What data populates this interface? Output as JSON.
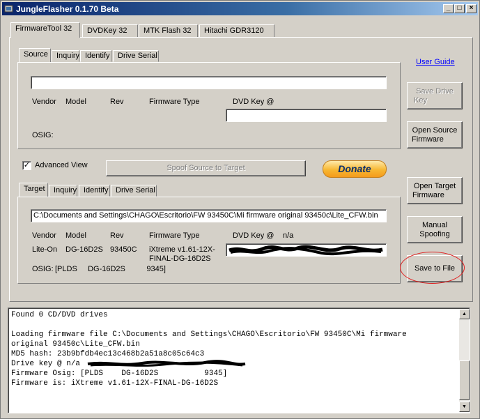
{
  "window": {
    "title": "JungleFlasher 0.1.70 Beta",
    "minimize": "_",
    "maximize": "□",
    "close": "×"
  },
  "main_tabs": [
    "FirmwareTool 32",
    "DVDKey 32",
    "MTK Flash 32",
    "Hitachi GDR3120"
  ],
  "source": {
    "tabs": [
      "Source",
      "Inquiry",
      "Identify",
      "Drive Serial"
    ],
    "path_value": "",
    "headers": {
      "vendor": "Vendor",
      "model": "Model",
      "rev": "Rev",
      "firmware_type": "Firmware Type",
      "dvd_key": "DVD Key @"
    },
    "dvd_key_value": "",
    "osig_label": "OSIG:"
  },
  "advanced_view": {
    "label": "Advanced View",
    "checked": "✓"
  },
  "spoof_button": "Spoof Source to Target",
  "donate_button": "Donate",
  "target": {
    "tabs": [
      "Target",
      "Inquiry",
      "Identify",
      "Drive Serial"
    ],
    "path_value": "C:\\Documents and Settings\\CHAGO\\Escritorio\\FW 93450C\\Mi firmware original 93450c\\Lite_CFW.bin",
    "headers": {
      "vendor": "Vendor",
      "model": "Model",
      "rev": "Rev",
      "firmware_type": "Firmware Type",
      "dvd_key": "DVD Key @",
      "dvd_key_at": "n/a"
    },
    "vendor": "Lite-On",
    "model": "DG-16D2S",
    "rev": "93450C",
    "firmware_type_line1": "iXtreme v1.61-12X-",
    "firmware_type_line2": "FINAL-DG-16D2S",
    "osig_label": "OSIG:",
    "osig_value": "[PLDS     DG-16D2S          9345]"
  },
  "right_buttons": {
    "user_guide": "User Guide",
    "save_drive_key": [
      "Save Drive",
      "Key"
    ],
    "open_source_firmware": [
      "Open Source",
      "Firmware"
    ],
    "open_target_firmware": [
      "Open Target",
      "Firmware"
    ],
    "manual_spoofing": [
      "Manual",
      "Spoofing"
    ],
    "save_to_file": "Save to File"
  },
  "log_lines": [
    "Found 0 CD/DVD drives",
    "",
    "Loading firmware file C:\\Documents and Settings\\CHAGO\\Escritorio\\FW 93450C\\Mi firmware",
    "original 93450c\\Lite_CFW.bin",
    "MD5 hash:  23b9bfdb4ec13c468b2a51a8c05c64c3",
    "Drive key @ n/a",
    "Firmware Osig: [PLDS    DG-16D2S          9345]",
    "Firmware is:  iXtreme v1.61-12X-FINAL-DG-16D2S"
  ],
  "colors": {
    "title_start": "#0a246a",
    "title_end": "#a6caf0",
    "face": "#d4d0c8",
    "annotation": "#e02020",
    "donate": "#f7b733"
  },
  "icons": [
    "app-icon",
    "minimize-icon",
    "maximize-icon",
    "close-icon",
    "scroll-up-icon",
    "scroll-down-icon"
  ]
}
